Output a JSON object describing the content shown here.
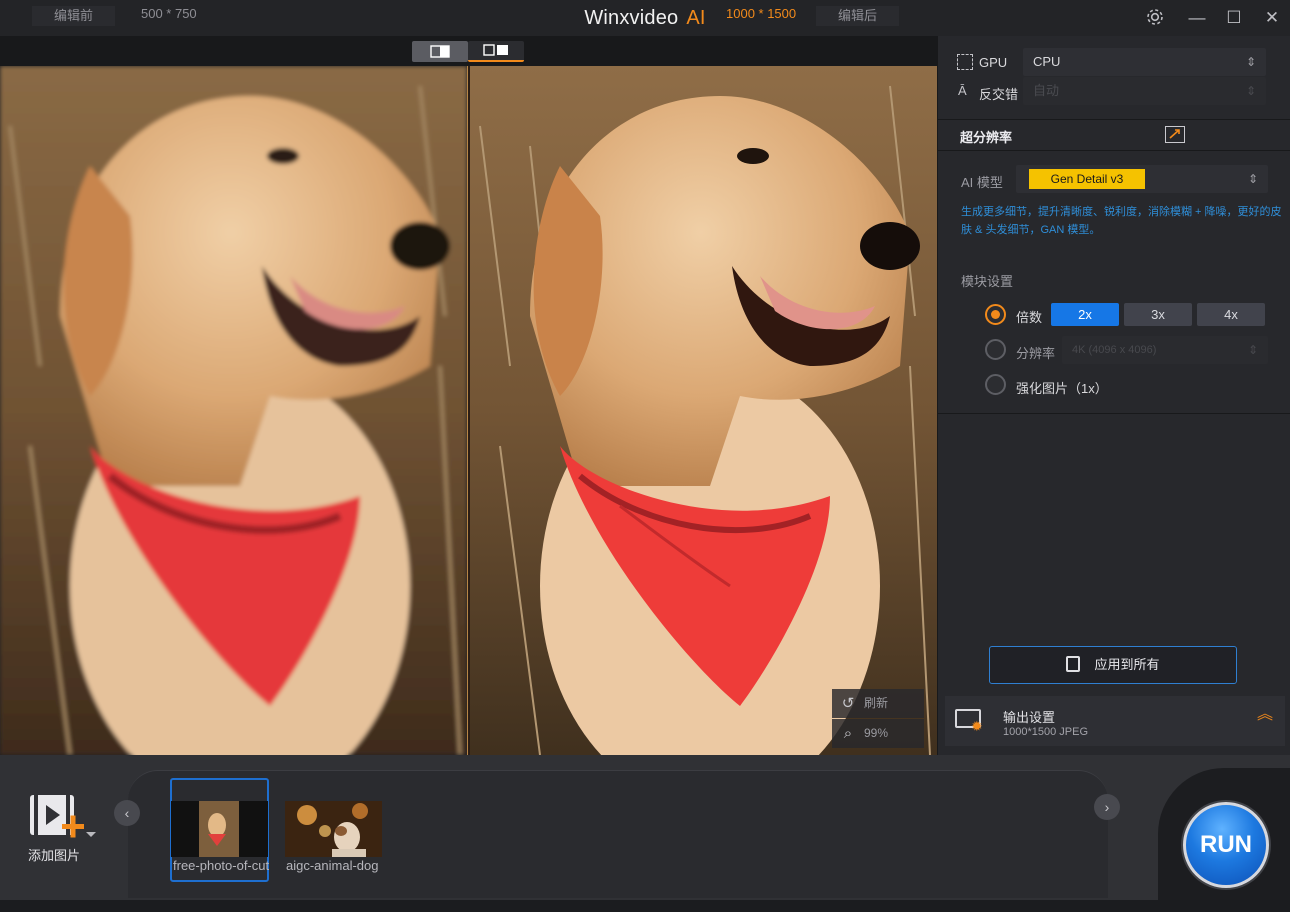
{
  "app": {
    "title": "Winxvideo",
    "title_ai": "AI"
  },
  "window": {
    "settings_icon": "gear-icon",
    "min": "—",
    "max": "☐",
    "close": "✕"
  },
  "compare": {
    "before_label": "编辑前",
    "before_res": "500 * 750",
    "after_res": "1000 * 1500",
    "after_label": "编辑后",
    "refresh_label": "刷新",
    "zoom_label": "99%"
  },
  "panel": {
    "gpu_label": "GPU",
    "gpu_value": "CPU",
    "deinterlace_label": "反交错",
    "deinterlace_value": "自动",
    "section_title": "超分辨率",
    "ai_model_label": "AI 模型",
    "ai_model_value": "Gen Detail v3",
    "description": "生成更多细节，提升清晰度、锐利度，消除模糊 + 降噪，更好的皮肤 & 头发细节，GAN 模型。",
    "module_settings_label": "模块设置",
    "scale_label": "倍数",
    "scale_options": [
      "2x",
      "3x",
      "4x"
    ],
    "scale_selected": "2x",
    "resolution_label": "分辨率",
    "resolution_value": "4K (4096 x 4096)",
    "enhance_label": "强化图片（1x）",
    "apply_all": "应用到所有",
    "output_title": "输出设置",
    "output_info": "1000*1500  JPEG"
  },
  "bottom": {
    "add_image_label": "添加图片",
    "thumbs": [
      {
        "caption": "free-photo-of-cute-dog"
      },
      {
        "caption": "aigc-animal-dog"
      }
    ],
    "run_label": "RUN"
  },
  "colors": {
    "accent": "#f28a1b",
    "blue": "#1677e6",
    "chip": "#f5c200",
    "link": "#2f8ed8"
  }
}
